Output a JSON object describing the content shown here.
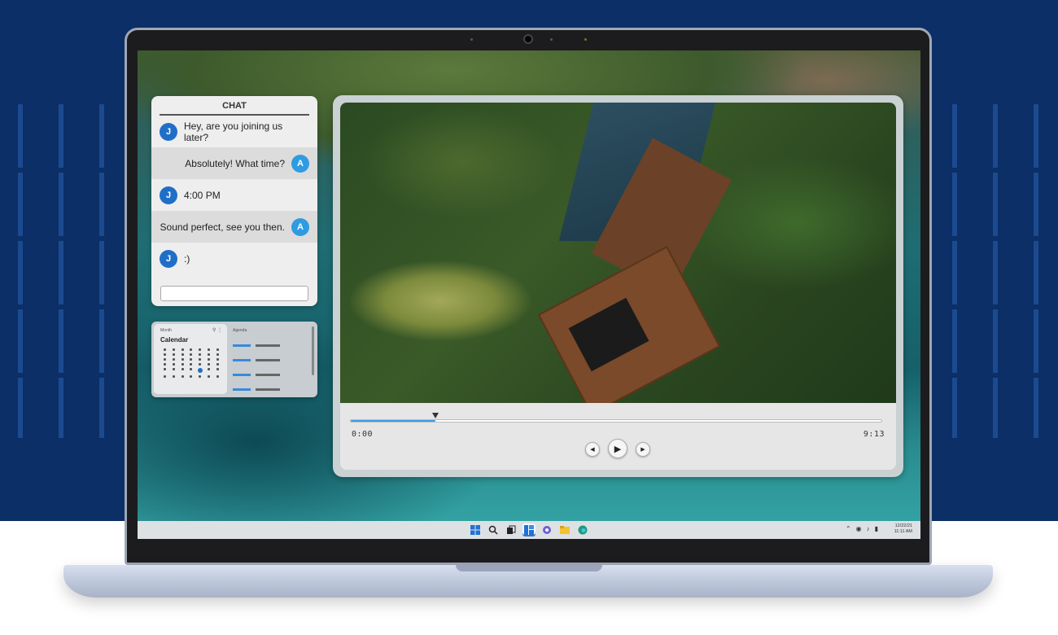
{
  "chat": {
    "title": "CHAT",
    "messages": [
      {
        "avatar": "J",
        "text": "Hey, are you joining us later?",
        "side": "left"
      },
      {
        "avatar": "A",
        "text": "Absolutely! What time?",
        "side": "right"
      },
      {
        "avatar": "J",
        "text": "4:00 PM",
        "side": "left"
      },
      {
        "avatar": "A",
        "text": "Sound perfect, see you then.",
        "side": "right"
      },
      {
        "avatar": "J",
        "text": ":)",
        "side": "left"
      }
    ],
    "input_value": ""
  },
  "calendar": {
    "view_label": "Month",
    "title": "Calendar",
    "agenda_label": "Agenda"
  },
  "player": {
    "current_time": "0:00",
    "duration": "9:13",
    "progress": 0.16,
    "prev_icon": "◀",
    "play_icon": "▶",
    "next_icon": "▶"
  },
  "taskbar": {
    "icons": [
      "windows-start-icon",
      "search-icon",
      "task-view-icon",
      "widgets-icon",
      "chat-app-icon",
      "file-explorer-icon",
      "edge-browser-icon"
    ],
    "clock_time": "11:11 AM",
    "clock_date": "12/22/21"
  },
  "colors": {
    "background_navy": "#0b2f66",
    "avatar_j": "#1f6fc8",
    "avatar_a": "#2f9be0",
    "progress": "#3a9ee6"
  }
}
